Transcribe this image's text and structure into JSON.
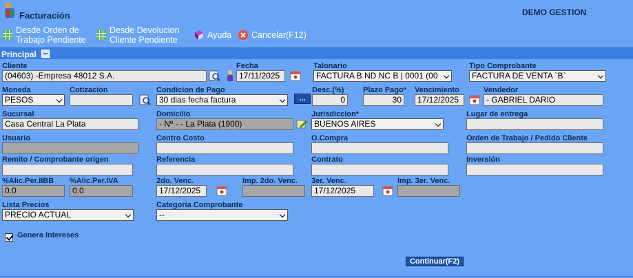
{
  "app": {
    "title": "Facturación",
    "brand": "DEMO GESTION"
  },
  "toolbar": {
    "desde_orden_l1": "Desde Orden de",
    "desde_orden_l2": "Trabajo Pendiente",
    "desde_devol_l1": "Desde Devolucion",
    "desde_devol_l2": "Cliente Pendiente",
    "ayuda": "Ayuda",
    "cancelar": "Cancelar(F12)"
  },
  "section": {
    "label": "Principal"
  },
  "form": {
    "cliente": {
      "label": "Cliente",
      "value": "(04603) -Empresa 48012 S.A."
    },
    "fecha": {
      "label": "Fecha",
      "value": "17/11/2025"
    },
    "talonario": {
      "label": "Talonario",
      "value": "FACTURA B ND NC B | 0001 (00"
    },
    "tipo_comprobante": {
      "label": "Tipo Comprobante",
      "value": "FACTURA DE VENTA `B`"
    },
    "moneda": {
      "label": "Moneda",
      "value": "PESOS"
    },
    "cotizacion": {
      "label": "Cotizacion",
      "value": ""
    },
    "condicion_pago": {
      "label": "Condicion de Pago",
      "value": "30 dias fecha factura"
    },
    "descuento": {
      "label": "Desc.(%)",
      "value": "0"
    },
    "plazo_pago": {
      "label": "Plazo Pago*",
      "value": "30"
    },
    "vencimiento": {
      "label": "Vencimiento",
      "value": "17/12/2025"
    },
    "vendedor": {
      "label": "Vendedor",
      "value": "- GABRIEL DARIO"
    },
    "sucursal": {
      "label": "Sucursal",
      "value": "Casa Central La Plata"
    },
    "domicilio": {
      "label": "Domicilio",
      "value": "- Nº - - La Plata (1900)"
    },
    "jurisdiccion": {
      "label": "Jurisdiccion*",
      "value": "BUENOS AIRES"
    },
    "lugar_entrega": {
      "label": "Lugar de entrega",
      "value": ""
    },
    "usuario": {
      "label": "Usuario",
      "value": ""
    },
    "centro_costo": {
      "label": "Centro Costo",
      "value": ""
    },
    "ocompra": {
      "label": "O.Compra",
      "value": ""
    },
    "orden_trabajo": {
      "label": "Orden de Trabajo / Pedido Cliente",
      "value": ""
    },
    "remito": {
      "label": "Remito / Comprobante origen",
      "value": ""
    },
    "referencia": {
      "label": "Referencia",
      "value": ""
    },
    "contrato": {
      "label": "Contrato",
      "value": ""
    },
    "inversion": {
      "label": "Inversión",
      "value": ""
    },
    "alic_iibb": {
      "label": "%Alic.Per.IIBB",
      "value": "0.0"
    },
    "alic_iva": {
      "label": "%Alic.Per.IVA",
      "value": "0.0"
    },
    "venc2": {
      "label": "2do. Venc.",
      "value": "17/12/2025"
    },
    "imp_venc2": {
      "label": "Imp. 2do. Venc.",
      "value": ""
    },
    "venc3": {
      "label": "3er. Venc.",
      "value": "17/12/2025"
    },
    "imp_venc3": {
      "label": "Imp. 3er. Venc.",
      "value": ""
    },
    "lista_precios": {
      "label": "Lista Precios",
      "value": "PRECIO ACTUAL"
    },
    "categoria": {
      "label": "Categoria Comprobante",
      "value": "--"
    },
    "genera_intereses": {
      "label": "Genera Intereses",
      "checked": true
    },
    "dots_label": "...",
    "continuar": "Continuar(F2)"
  }
}
